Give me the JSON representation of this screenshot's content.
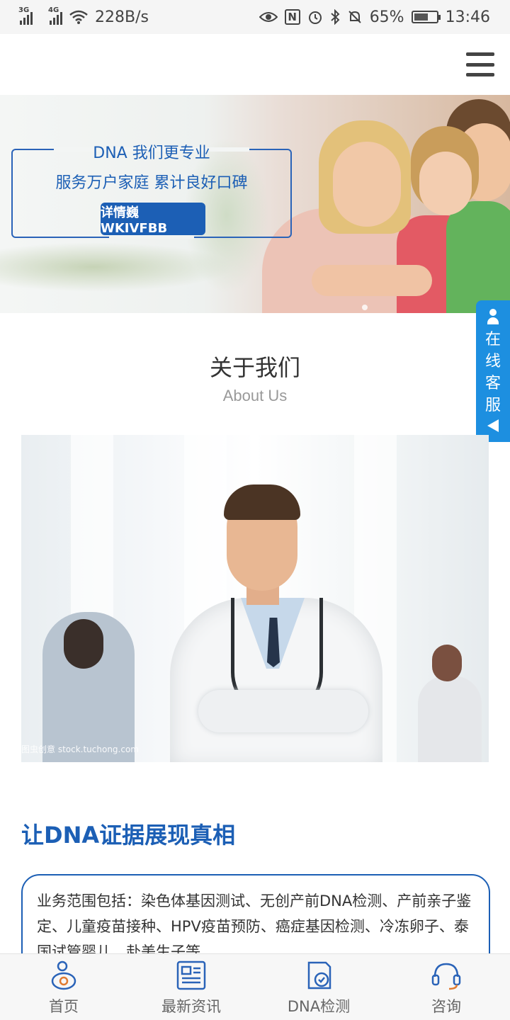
{
  "status_bar": {
    "signal1": "3G",
    "signal2": "4G",
    "network_speed": "228B/s",
    "nfc": "N",
    "battery_percent": "65%",
    "time": "13:46",
    "battery_level": 0.65
  },
  "banner": {
    "title": "DNA 我们更专业",
    "subtitle": "服务万户家庭 累计良好口碑",
    "button_label": "详情巍 WKIVFBB"
  },
  "side_service": {
    "label": "在线客服"
  },
  "about": {
    "title": "关于我们",
    "subtitle": "About Us",
    "watermark": "图虫创意 stock.tuchong.com"
  },
  "slogan": "让DNA证据展现真相",
  "intro_text": "业务范围包括：染色体基因测试、无创产前DNA检测、产前亲子鉴定、儿童疫苗接种、HPV疫苗预防、癌症基因检测、冷冻卵子、泰国试管婴儿、赴美生子等",
  "bottom_nav": [
    {
      "label": "首页",
      "icon": "home-baby-icon"
    },
    {
      "label": "最新资讯",
      "icon": "news-icon"
    },
    {
      "label": "DNA检测",
      "icon": "dna-check-icon"
    },
    {
      "label": "咨询",
      "icon": "headset-icon"
    }
  ],
  "colors": {
    "brand_blue": "#1c5fb5",
    "side_blue": "#1d8fe0"
  }
}
